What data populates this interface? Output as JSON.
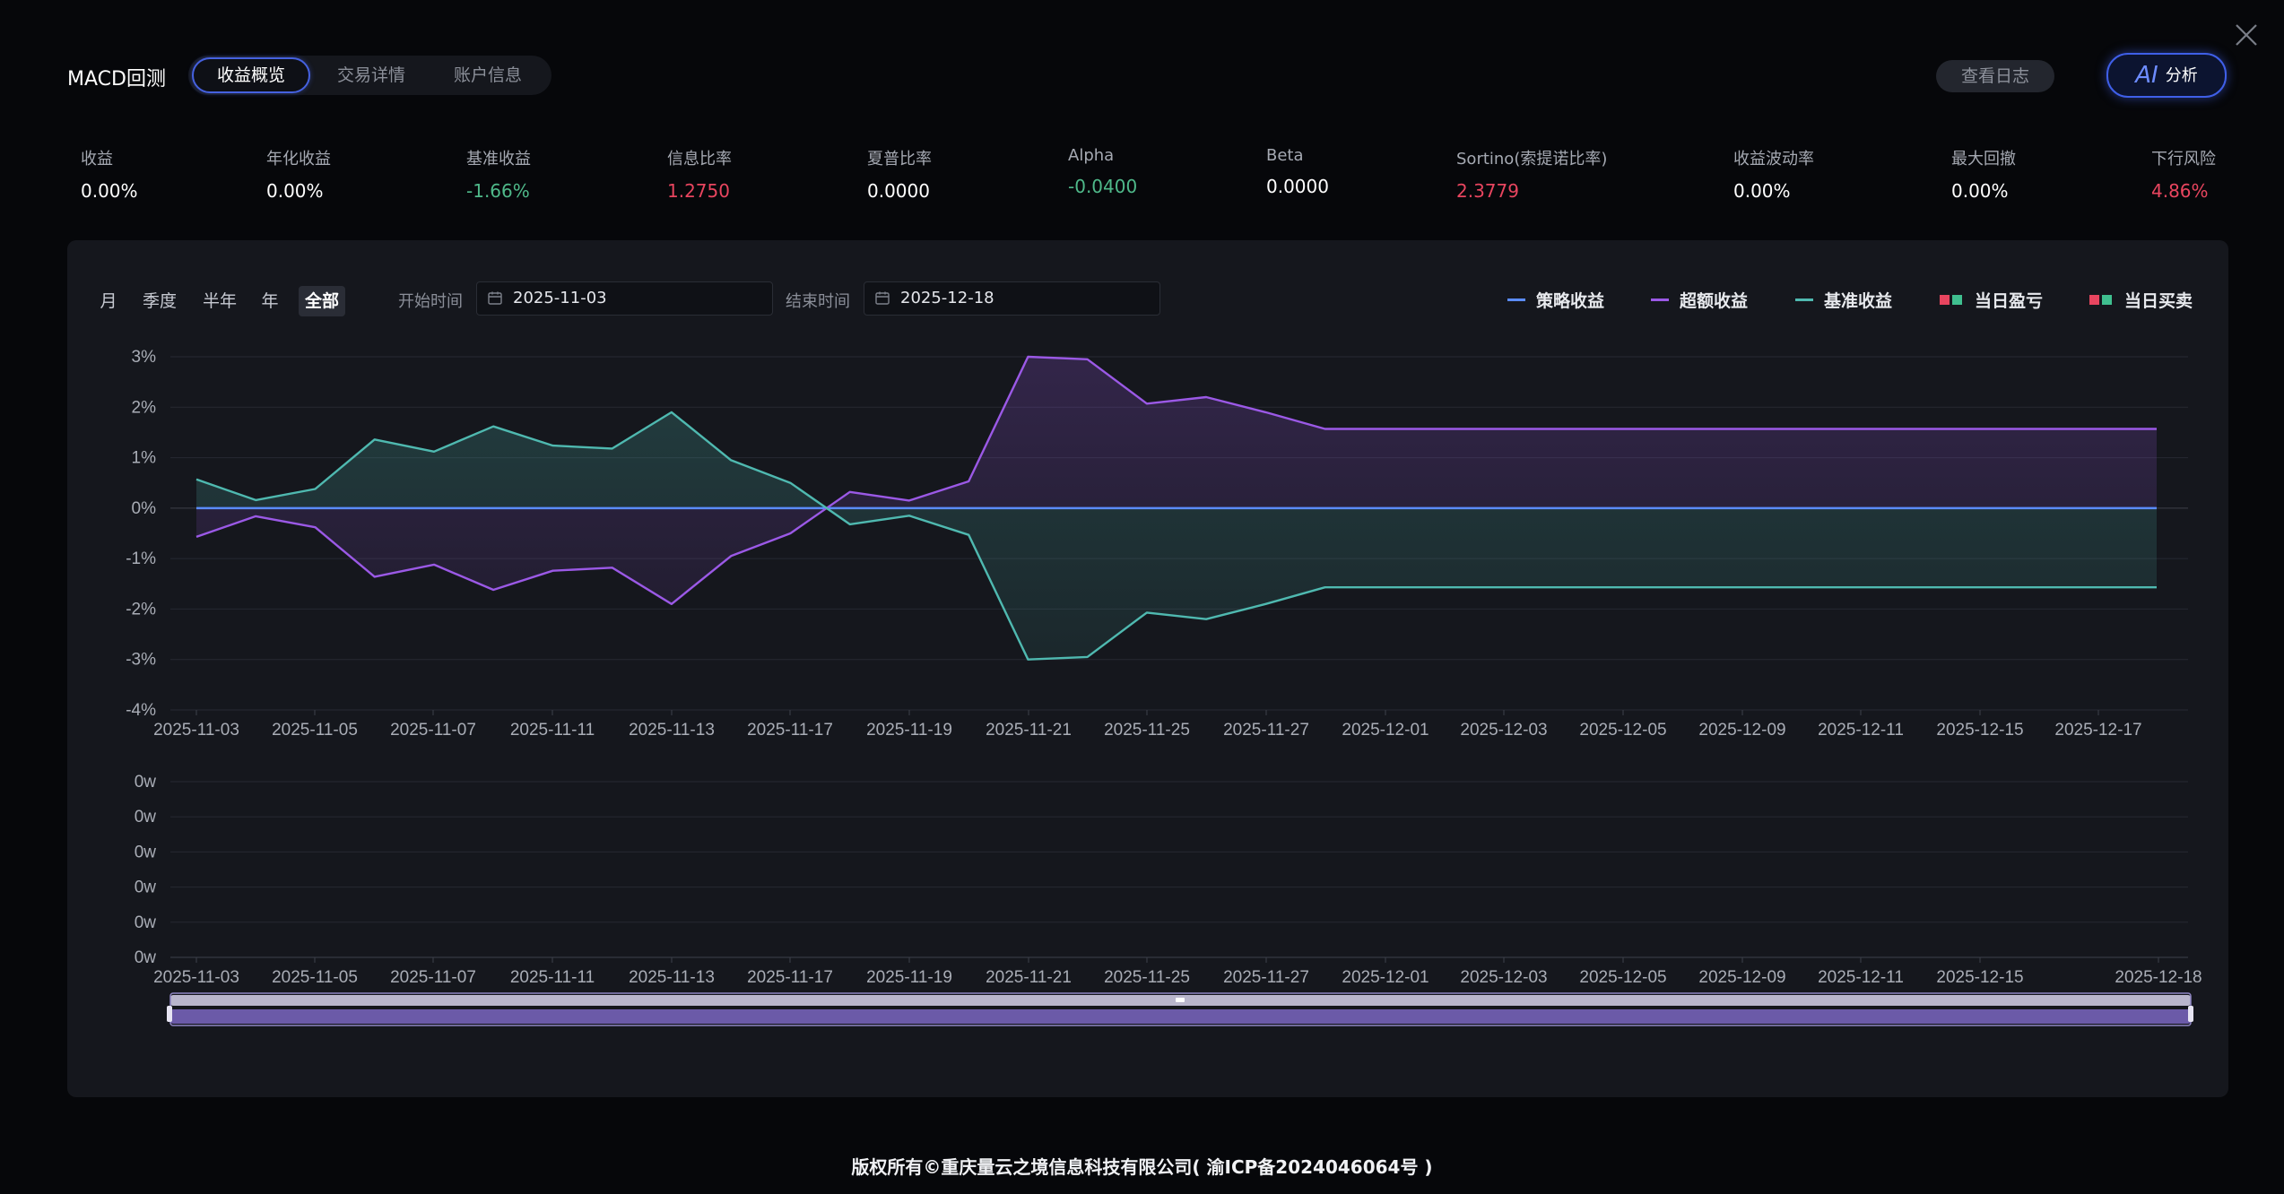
{
  "header": {
    "title": "MACD回测",
    "tabs": [
      {
        "label": "收益概览",
        "active": true
      },
      {
        "label": "交易详情",
        "active": false
      },
      {
        "label": "账户信息",
        "active": false
      }
    ],
    "log_button": "查看日志",
    "ai_button": {
      "badge": "AI",
      "label": "分析"
    }
  },
  "metrics": [
    {
      "label": "收益",
      "value": "0.00%",
      "tone": "neutral"
    },
    {
      "label": "年化收益",
      "value": "0.00%",
      "tone": "neutral"
    },
    {
      "label": "基准收益",
      "value": "-1.66%",
      "tone": "green"
    },
    {
      "label": "信息比率",
      "value": "1.2750",
      "tone": "red"
    },
    {
      "label": "夏普比率",
      "value": "0.0000",
      "tone": "neutral"
    },
    {
      "label": "Alpha",
      "value": "-0.0400",
      "tone": "green"
    },
    {
      "label": "Beta",
      "value": "0.0000",
      "tone": "neutral"
    },
    {
      "label": "Sortino(索提诺比率)",
      "value": "2.3779",
      "tone": "red"
    },
    {
      "label": "收益波动率",
      "value": "0.00%",
      "tone": "neutral"
    },
    {
      "label": "最大回撤",
      "value": "0.00%",
      "tone": "neutral"
    },
    {
      "label": "下行风险",
      "value": "4.86%",
      "tone": "red"
    }
  ],
  "tone_colors": {
    "neutral": "#ffffff",
    "green": "#4fb98a",
    "red": "#e8455f"
  },
  "periods": [
    {
      "label": "月",
      "active": false
    },
    {
      "label": "季度",
      "active": false
    },
    {
      "label": "半年",
      "active": false
    },
    {
      "label": "年",
      "active": false
    },
    {
      "label": "全部",
      "active": true
    }
  ],
  "date_range": {
    "start_label": "开始时间",
    "start_value": "2025-11-03",
    "end_label": "结束时间",
    "end_value": "2025-12-18"
  },
  "legend": [
    {
      "label": "策略收益",
      "color": "#5b8cff",
      "kind": "line"
    },
    {
      "label": "超额收益",
      "color": "#9b59e6",
      "kind": "line"
    },
    {
      "label": "基准收益",
      "color": "#4fb9b0",
      "kind": "line"
    },
    {
      "label": "当日盈亏",
      "colors": [
        "#e8455f",
        "#3fbf8f"
      ],
      "kind": "squares"
    },
    {
      "label": "当日买卖",
      "colors": [
        "#e8455f",
        "#3fbf8f"
      ],
      "kind": "squares"
    }
  ],
  "chart_data": [
    {
      "type": "line",
      "title": "",
      "y_ticks": [
        "3%",
        "2%",
        "1%",
        "0%",
        "-1%",
        "-2%",
        "-3%",
        "-4%"
      ],
      "ylim": [
        -4,
        3
      ],
      "x_tick_labels": [
        "2025-11-03",
        "2025-11-05",
        "2025-11-07",
        "2025-11-11",
        "2025-11-13",
        "2025-11-17",
        "2025-11-19",
        "2025-11-21",
        "2025-11-25",
        "2025-11-27",
        "2025-12-01",
        "2025-12-03",
        "2025-12-05",
        "2025-12-09",
        "2025-12-11",
        "2025-12-15",
        "2025-12-17"
      ],
      "x": [
        "2025-11-03",
        "2025-11-04",
        "2025-11-05",
        "2025-11-06",
        "2025-11-07",
        "2025-11-10",
        "2025-11-11",
        "2025-11-12",
        "2025-11-13",
        "2025-11-14",
        "2025-11-17",
        "2025-11-18",
        "2025-11-19",
        "2025-11-20",
        "2025-11-21",
        "2025-11-24",
        "2025-11-25",
        "2025-11-26",
        "2025-11-27",
        "2025-11-28",
        "2025-12-01",
        "2025-12-02",
        "2025-12-03",
        "2025-12-04",
        "2025-12-05",
        "2025-12-08",
        "2025-12-09",
        "2025-12-10",
        "2025-12-11",
        "2025-12-12",
        "2025-12-15",
        "2025-12-16",
        "2025-12-17",
        "2025-12-18"
      ],
      "series": [
        {
          "name": "策略收益",
          "color": "#5b8cff",
          "values": [
            0,
            0,
            0,
            0,
            0,
            0,
            0,
            0,
            0,
            0,
            0,
            0,
            0,
            0,
            0,
            0,
            0,
            0,
            0,
            0,
            0,
            0,
            0,
            0,
            0,
            0,
            0,
            0,
            0,
            0,
            0,
            0,
            0,
            0
          ]
        },
        {
          "name": "超额收益",
          "color": "#9b59e6",
          "values": [
            -0.57,
            -0.16,
            -0.38,
            -1.36,
            -1.12,
            -1.62,
            -1.24,
            -1.18,
            -1.9,
            -0.95,
            -0.5,
            0.32,
            0.15,
            0.53,
            3.0,
            2.95,
            2.07,
            2.2,
            1.9,
            1.57,
            1.57,
            1.57,
            1.57,
            1.57,
            1.57,
            1.57,
            1.57,
            1.57,
            1.57,
            1.57,
            1.57,
            1.57,
            1.57,
            1.57
          ]
        },
        {
          "name": "基准收益",
          "color": "#4fb9b0",
          "values": [
            0.57,
            0.16,
            0.38,
            1.36,
            1.12,
            1.62,
            1.24,
            1.18,
            1.9,
            0.95,
            0.5,
            -0.32,
            -0.15,
            -0.53,
            -3.0,
            -2.95,
            -2.07,
            -2.2,
            -1.9,
            -1.57,
            -1.57,
            -1.57,
            -1.57,
            -1.57,
            -1.57,
            -1.57,
            -1.57,
            -1.57,
            -1.57,
            -1.57,
            -1.57,
            -1.57,
            -1.57,
            -1.57
          ]
        }
      ]
    },
    {
      "type": "bar",
      "y_ticks": [
        "0w",
        "0w",
        "0w",
        "0w",
        "0w",
        "0w"
      ],
      "x_tick_labels": [
        "2025-11-03",
        "2025-11-05",
        "2025-11-07",
        "2025-11-11",
        "2025-11-13",
        "2025-11-17",
        "2025-11-19",
        "2025-11-21",
        "2025-11-25",
        "2025-11-27",
        "2025-12-01",
        "2025-12-03",
        "2025-12-05",
        "2025-12-09",
        "2025-12-11",
        "2025-12-15",
        "2025-12-18"
      ],
      "series": []
    }
  ],
  "footer": "版权所有©重庆量云之境信息科技有限公司( 渝ICP备2024046064号 )"
}
